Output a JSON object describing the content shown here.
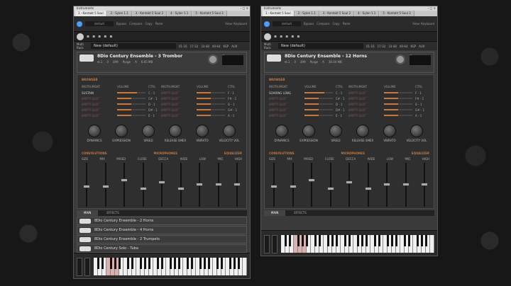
{
  "background": {
    "color": "#171717"
  },
  "left": {
    "title": "Instruments",
    "tabs": [
      "1 - Kontakt 5 Soul",
      "2 - Sylen 1.1",
      "3 - Kontakt 5 Soul 2",
      "4 - Sylen 1.1",
      "5 - Kontakt 5 Soul 3"
    ],
    "toolbar": {
      "preset": "default",
      "labels": [
        "Bypass",
        "Compare",
        "Copy",
        "Paste"
      ],
      "view": "View: Keyboard"
    },
    "rack": {
      "label": "Multi Rack",
      "name": "New (default)",
      "ranges": [
        "01-16",
        "17-32",
        "33-48",
        "49-64",
        "KSP",
        "AUX"
      ]
    },
    "instrument": {
      "title": "8Dio Century Ensemble - 3 Trombor",
      "output": "st.1",
      "voices": "0",
      "max": "499",
      "purge": "Purge",
      "midi": "A",
      "memory": "6.65 MB",
      "tune": "Tune",
      "tune_val": "0.00"
    },
    "browser": "BROWSER",
    "grid_headers": [
      "INSTRUMENT",
      "VOLUME",
      "CTRL",
      "INSTRUMENT",
      "VOLUME",
      "CTRL"
    ],
    "rows_left": [
      {
        "name": "SUSTAIN",
        "ctrl": "C - 1",
        "vol": 0.7
      },
      {
        "name": "EMPTY SLOT",
        "ctrl": "C# - 1",
        "vol": 0.5
      },
      {
        "name": "EMPTY SLOT",
        "ctrl": "D - 1",
        "vol": 0.5
      },
      {
        "name": "EMPTY SLOT",
        "ctrl": "D# - 1",
        "vol": 0.5
      },
      {
        "name": "EMPTY SLOT",
        "ctrl": "E - 1",
        "vol": 0.5
      }
    ],
    "rows_right": [
      {
        "name": "EMPTY SLOT",
        "ctrl": "F - 1",
        "vol": 0.5
      },
      {
        "name": "EMPTY SLOT",
        "ctrl": "F# - 1",
        "vol": 0.5
      },
      {
        "name": "EMPTY SLOT",
        "ctrl": "G - 1",
        "vol": 0.5
      },
      {
        "name": "EMPTY SLOT",
        "ctrl": "G# - 1",
        "vol": 0.5
      },
      {
        "name": "EMPTY SLOT",
        "ctrl": "A - 1",
        "vol": 0.5
      }
    ],
    "knobs": [
      "DYNAMICS",
      "EXPRESSION",
      "SPEED",
      "RELEASE SMEX",
      "VIBRATO",
      "VELOCITY VOL"
    ],
    "sections": [
      "CONVOLUTIONS",
      "MICROPHONES",
      "EQUALIZER"
    ],
    "mixer": [
      "SIZE",
      "MIX",
      "MIXED",
      "CLOSE",
      "DECCA",
      "WIDE",
      "LOW",
      "MID",
      "HIGH"
    ],
    "bottom_tabs": [
      "MAIN",
      "EFFECTS"
    ],
    "strips": [
      "8Dio Century Ensemble - 2 Horns",
      "8Dio Century Ensemble - 4 Horns",
      "8Dio Century Ensemble - 2 Trumpets",
      "8Dio Century Solo - Tuba"
    ]
  },
  "right": {
    "title": "Instruments",
    "tabs": [
      "1 - Kontakt 5 Soul",
      "2 - Sylen 1.1",
      "3 - Kontakt 5 Soul 2",
      "4 - Sylen 1.1",
      "5 - Kontakt 5 Soul 3"
    ],
    "toolbar": {
      "preset": "default",
      "labels": [
        "Bypass",
        "Compare",
        "Copy",
        "Paste"
      ],
      "view": "View: Keyboard"
    },
    "rack": {
      "label": "Multi Rack",
      "name": "New (default)",
      "ranges": [
        "01-16",
        "17-32",
        "33-48",
        "49-64",
        "KSP",
        "AUX"
      ]
    },
    "instrument": {
      "title": "8Dio Century Ensemble - 12 Horns",
      "output": "st.1",
      "voices": "0",
      "max": "499",
      "purge": "Purge",
      "midi": "A",
      "memory": "36.04 MB",
      "tune": "Tune",
      "tune_val": "0.00"
    },
    "browser": "BROWSER",
    "grid_headers": [
      "INSTRUMENT",
      "VOLUME",
      "CTRL",
      "INSTRUMENT",
      "VOLUME",
      "CTRL"
    ],
    "rows_left": [
      {
        "name": "SOARING LONG",
        "ctrl": "C - 1",
        "vol": 0.7
      },
      {
        "name": "EMPTY SLOT",
        "ctrl": "C# - 1",
        "vol": 0.5
      },
      {
        "name": "EMPTY SLOT",
        "ctrl": "D - 1",
        "vol": 0.5
      },
      {
        "name": "EMPTY SLOT",
        "ctrl": "D# - 1",
        "vol": 0.5
      },
      {
        "name": "EMPTY SLOT",
        "ctrl": "E - 1",
        "vol": 0.5
      }
    ],
    "rows_right": [
      {
        "name": "EMPTY SLOT",
        "ctrl": "F - 1",
        "vol": 0.5
      },
      {
        "name": "EMPTY SLOT",
        "ctrl": "F# - 1",
        "vol": 0.5
      },
      {
        "name": "EMPTY SLOT",
        "ctrl": "G - 1",
        "vol": 0.5
      },
      {
        "name": "EMPTY SLOT",
        "ctrl": "G# - 1",
        "vol": 0.5
      },
      {
        "name": "EMPTY SLOT",
        "ctrl": "A - 1",
        "vol": 0.5
      }
    ],
    "knobs": [
      "DYNAMICS",
      "EXPRESSION",
      "SPEED",
      "RELEASE SMEX",
      "VIBRATO",
      "VELOCITY VOL"
    ],
    "sections": [
      "CONVOLUTIONS",
      "MICROPHONES",
      "EQUALIZER"
    ],
    "mixer": [
      "SIZE",
      "MIX",
      "MIXED",
      "CLOSE",
      "DECCA",
      "WIDE",
      "LOW",
      "MID",
      "HIGH"
    ],
    "bottom_tabs": [
      "MAIN",
      "EFFECTS"
    ]
  }
}
